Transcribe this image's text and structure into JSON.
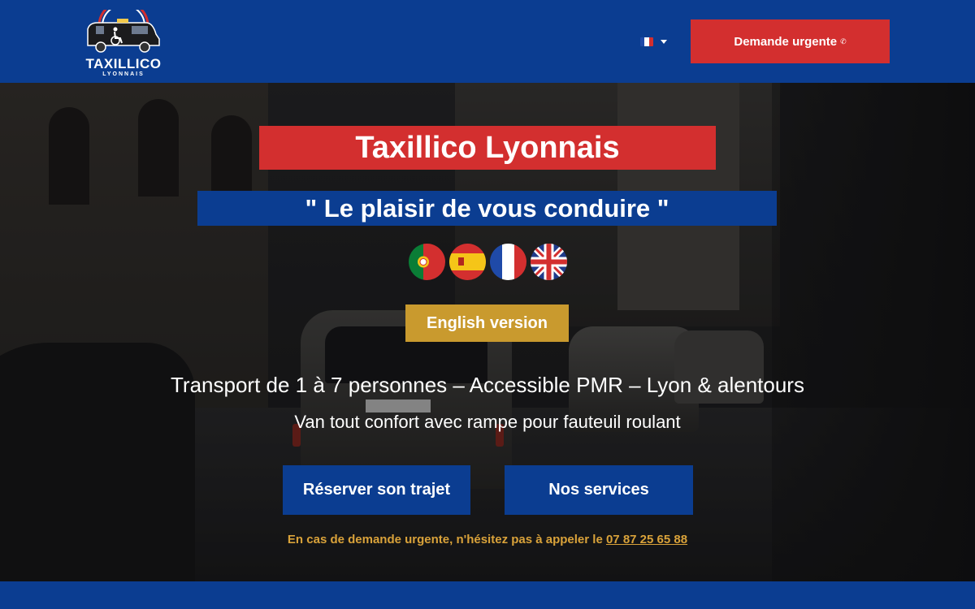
{
  "header": {
    "logo": {
      "title": "TAXILLICO",
      "subtitle": "LYONNAIS"
    },
    "language": {
      "selected": "fr-flag-icon"
    },
    "urgent_button": {
      "label": "Demande urgente",
      "icon": "phone-icon"
    }
  },
  "hero": {
    "title": "Taxillico Lyonnais",
    "slogan": "\" Le plaisir de vous conduire \"",
    "flags": [
      "pt-flag-icon",
      "es-flag-icon",
      "fr-flag-icon",
      "gb-flag-icon"
    ],
    "english_button": "English version",
    "tagline": "Transport de 1 à 7 personnes – Accessible PMR – Lyon & alentours",
    "subtagline": "Van tout confort avec rampe pour fauteuil roulant",
    "buttons": {
      "reserve": "Réserver son trajet",
      "services": "Nos services"
    },
    "urgent_note": {
      "text": "En cas de demande urgente, n'hésitez pas à appeler le ",
      "phone": "07 87 25 65 88"
    }
  },
  "colors": {
    "brand_blue": "#0b3d91",
    "brand_red": "#d32f2f",
    "gold": "#c99a2e"
  }
}
